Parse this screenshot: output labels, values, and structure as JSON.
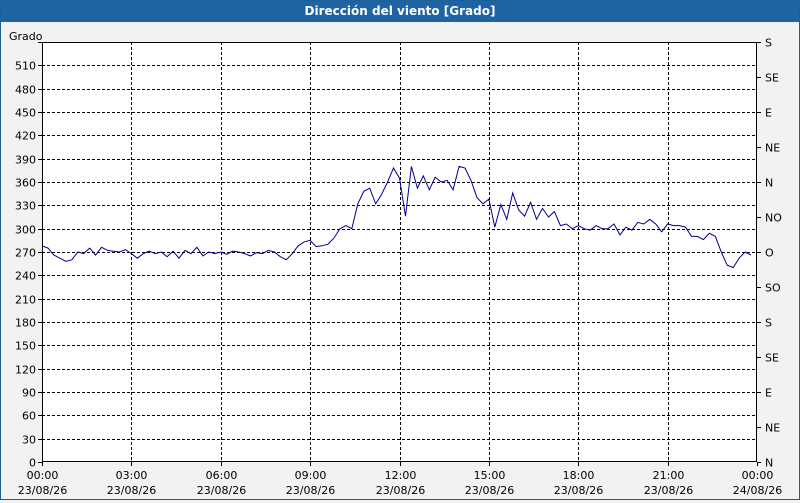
{
  "window": {
    "title": "Dirección del viento [Grado]"
  },
  "chart_data": {
    "type": "line",
    "title": "Dirección del viento [Grado]",
    "ylabel": "Grado",
    "ylim": [
      0,
      540
    ],
    "y_ticks": [
      0,
      30,
      60,
      90,
      120,
      150,
      180,
      210,
      240,
      270,
      300,
      330,
      360,
      390,
      420,
      450,
      480,
      510
    ],
    "y2_labels": [
      {
        "value": 0,
        "label": "N"
      },
      {
        "value": 45,
        "label": "NE"
      },
      {
        "value": 90,
        "label": "E"
      },
      {
        "value": 135,
        "label": "SE"
      },
      {
        "value": 180,
        "label": "S"
      },
      {
        "value": 225,
        "label": "SO"
      },
      {
        "value": 270,
        "label": "O"
      },
      {
        "value": 315,
        "label": "NO"
      },
      {
        "value": 360,
        "label": "N"
      },
      {
        "value": 405,
        "label": "NE"
      },
      {
        "value": 450,
        "label": "E"
      },
      {
        "value": 495,
        "label": "SE"
      },
      {
        "value": 540,
        "label": "S"
      }
    ],
    "xlim": [
      0,
      24
    ],
    "x_ticks": [
      {
        "hour": 0,
        "time": "00:00",
        "date": "23/08/26"
      },
      {
        "hour": 3,
        "time": "03:00",
        "date": "23/08/26"
      },
      {
        "hour": 6,
        "time": "06:00",
        "date": "23/08/26"
      },
      {
        "hour": 9,
        "time": "09:00",
        "date": "23/08/26"
      },
      {
        "hour": 12,
        "time": "12:00",
        "date": "23/08/26"
      },
      {
        "hour": 15,
        "time": "15:00",
        "date": "23/08/26"
      },
      {
        "hour": 18,
        "time": "18:00",
        "date": "23/08/26"
      },
      {
        "hour": 21,
        "time": "21:00",
        "date": "23/08/26"
      },
      {
        "hour": 24,
        "time": "00:00",
        "date": "24/08/26"
      }
    ],
    "grid": true,
    "line_color": "#00008b",
    "series": [
      {
        "x": [
          0,
          0.2,
          0.4,
          0.6,
          0.8,
          1.0,
          1.2,
          1.4,
          1.6,
          1.8,
          2.0,
          2.2,
          2.4,
          2.6,
          2.8,
          3.0,
          3.2,
          3.4,
          3.6,
          3.8,
          4.0,
          4.2,
          4.4,
          4.6,
          4.8,
          5.0,
          5.2,
          5.4,
          5.6,
          5.8,
          6.0,
          6.2,
          6.4,
          6.6,
          6.8,
          7.0,
          7.2,
          7.4,
          7.6,
          7.8,
          8.0,
          8.2,
          8.4,
          8.6,
          8.8,
          9.0,
          9.2,
          9.4,
          9.6,
          9.8,
          10.0,
          10.2,
          10.4,
          10.6,
          10.8,
          11.0,
          11.2,
          11.4,
          11.6,
          11.8,
          12.0,
          12.2,
          12.4,
          12.6,
          12.8,
          13.0,
          13.2,
          13.4,
          13.6,
          13.8,
          14.0,
          14.2,
          14.4,
          14.6,
          14.8,
          15.0,
          15.2,
          15.4,
          15.6,
          15.8,
          16.0,
          16.2,
          16.4,
          16.6,
          16.8,
          17.0,
          17.2,
          17.4,
          17.6,
          17.8,
          18.0,
          18.2,
          18.4,
          18.6,
          18.8,
          19.0,
          19.2,
          19.4,
          19.6,
          19.8,
          20.0,
          20.2,
          20.4,
          20.6,
          20.8,
          21.0,
          21.2,
          21.4,
          21.6,
          21.8,
          22.0,
          22.2,
          22.4,
          22.6,
          22.8,
          23.0,
          23.2,
          23.4,
          23.6,
          23.8
        ],
        "y": [
          278,
          275,
          266,
          262,
          258,
          260,
          270,
          268,
          275,
          266,
          276,
          272,
          271,
          270,
          273,
          268,
          262,
          268,
          271,
          268,
          270,
          264,
          271,
          262,
          272,
          268,
          276,
          265,
          270,
          268,
          270,
          267,
          271,
          270,
          268,
          265,
          269,
          268,
          272,
          270,
          264,
          260,
          268,
          278,
          283,
          285,
          277,
          278,
          280,
          288,
          300,
          304,
          300,
          332,
          348,
          352,
          332,
          344,
          360,
          378,
          365,
          316,
          380,
          352,
          368,
          350,
          366,
          360,
          362,
          350,
          380,
          378,
          362,
          340,
          332,
          338,
          302,
          331,
          312,
          346,
          324,
          316,
          334,
          312,
          326,
          315,
          322,
          304,
          306,
          300,
          304,
          300,
          298,
          304,
          300,
          300,
          306,
          292,
          302,
          298,
          308,
          306,
          312,
          306,
          296,
          306,
          304,
          304,
          302,
          290,
          290,
          286,
          294,
          290,
          270,
          253,
          250,
          262,
          270,
          266
        ]
      }
    ]
  }
}
